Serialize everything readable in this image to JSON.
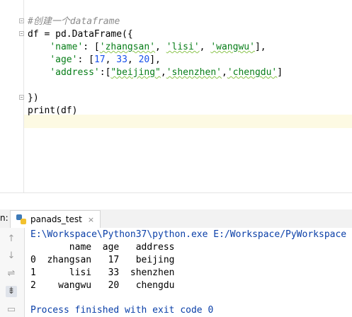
{
  "editor": {
    "lines": {
      "comment": "#创建一个dataframe",
      "l2_var": "df",
      "l2_rest": " = pd.DataFrame({",
      "l3_key": "'name'",
      "l3_colon": ": [",
      "l3_v1": "'zhangsan'",
      "l3_v2": "'lisi'",
      "l3_v3": "'wangwu'",
      "l3_end": "],",
      "l4_key": "'age'",
      "l4_colon": ": [",
      "l4_n1": "17",
      "l4_n2": "33",
      "l4_n3": "20",
      "l4_end": "],",
      "l5_key": "'address'",
      "l5_colon": ":[",
      "l5_v1": "\"beijing\"",
      "l5_v2": "'shenzhen'",
      "l5_v3": "'chengdu'",
      "l5_end": "]",
      "l7": "})",
      "l8": "print(df)"
    }
  },
  "run": {
    "label": "n:",
    "tab_title": "panads_test",
    "close_icon": "×"
  },
  "console": {
    "command": "E:\\Workspace\\Python37\\python.exe E:/Workspace/PyWorkspace",
    "table_header": "       name  age   address",
    "rows": [
      "0  zhangsan   17   beijing",
      "1      lisi   33  shenzhen",
      "2    wangwu   20   chengdu"
    ],
    "finished": "Process finished with exit code 0"
  },
  "colors": {
    "keyword": "#0033b3",
    "string": "#067d17",
    "number": "#1750eb",
    "comment": "#8c8c8c",
    "caret_line": "#fdfae3"
  }
}
